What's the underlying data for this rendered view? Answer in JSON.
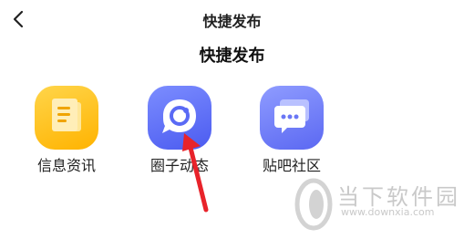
{
  "header": {
    "title": "快捷发布",
    "back_icon": "chevron-left-icon"
  },
  "section": {
    "title": "快捷发布"
  },
  "tiles": [
    {
      "label": "信息资讯",
      "icon": "document-icon",
      "color": "#ffc107"
    },
    {
      "label": "圈子动态",
      "icon": "chat-bubble-icon",
      "color": "#5a6af5"
    },
    {
      "label": "贴吧社区",
      "icon": "message-dots-icon",
      "color": "#6a77f5"
    }
  ],
  "annotation": {
    "arrow_color": "#e8232a"
  },
  "watermark": {
    "name": "当下软件园",
    "url": "www.downxia.com"
  }
}
